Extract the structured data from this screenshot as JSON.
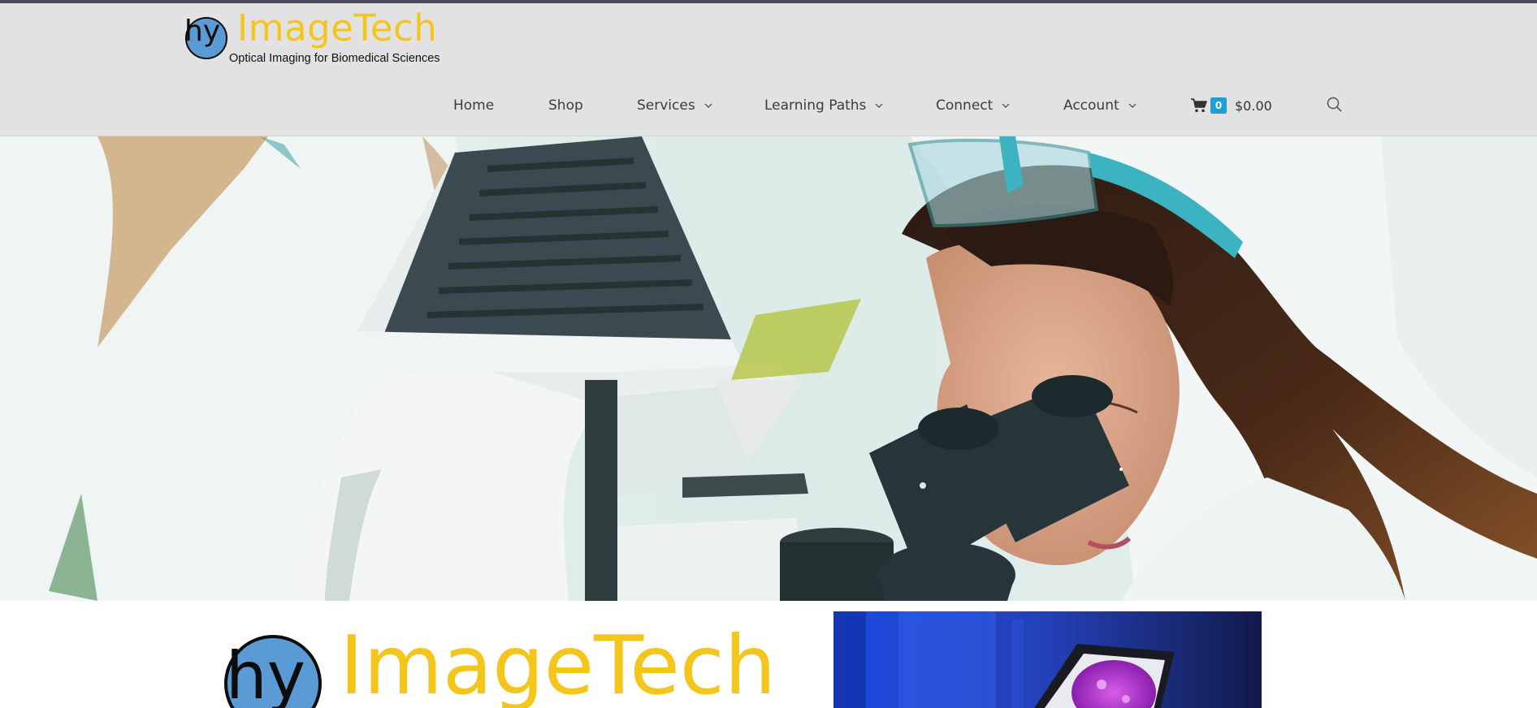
{
  "brand": {
    "name": "ImageTech",
    "mark": "hy",
    "tagline": "Optical Imaging for Biomedical Sciences",
    "colors": {
      "wordmark": "#f4c61c",
      "mark_circle": "#5b9bd5",
      "header_bg": "#e2e2e2"
    }
  },
  "nav": {
    "items": [
      {
        "label": "Home",
        "has_dropdown": false
      },
      {
        "label": "Shop",
        "has_dropdown": false
      },
      {
        "label": "Services",
        "has_dropdown": true
      },
      {
        "label": "Learning Paths",
        "has_dropdown": true
      },
      {
        "label": "Connect",
        "has_dropdown": true
      },
      {
        "label": "Account",
        "has_dropdown": true
      }
    ]
  },
  "cart": {
    "icon": "cart-icon",
    "count": "0",
    "total": "$0.00",
    "badge_color": "#1ea0d6"
  },
  "search": {
    "icon": "search-icon"
  },
  "hero": {
    "image": "scientist-looking-into-microscope-photo"
  },
  "content": {
    "logo_name": "ImageTech",
    "logo_mark": "hy",
    "side_image": "fluorescence-microscopy-monitor-photo"
  }
}
